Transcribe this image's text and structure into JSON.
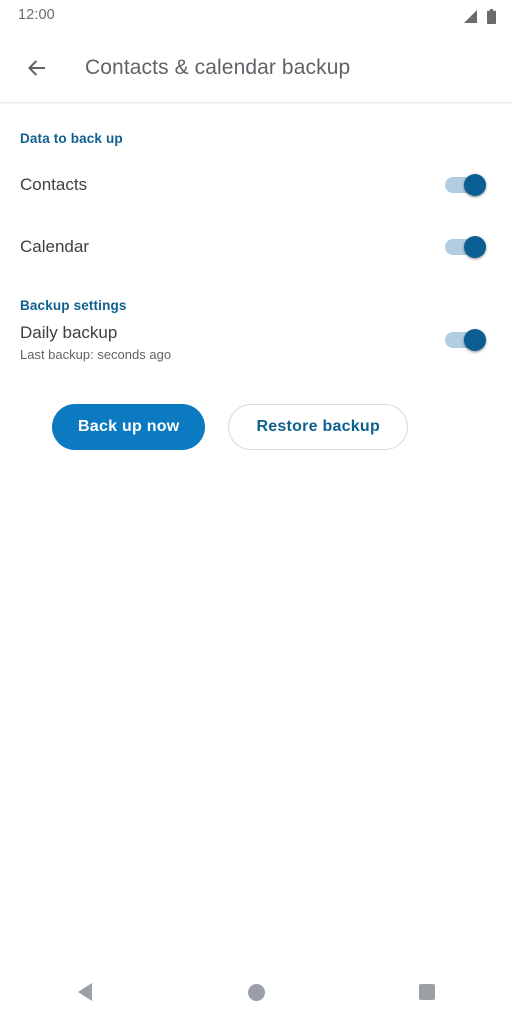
{
  "status_bar": {
    "time": "12:00",
    "signal_icon": "signal-bars-icon",
    "battery_icon": "battery-full-icon"
  },
  "app_bar": {
    "back_icon": "back-arrow-icon",
    "title": "Contacts & calendar backup"
  },
  "sections": {
    "data_to_back_up": {
      "header": "Data to back up",
      "rows": [
        {
          "title": "Contacts",
          "switch_state": "on"
        },
        {
          "title": "Calendar",
          "switch_state": "on"
        }
      ]
    },
    "backup_settings": {
      "header": "Backup settings",
      "rows": [
        {
          "title": "Daily backup",
          "subtitle": "Last backup: seconds ago",
          "switch_state": "on"
        }
      ]
    }
  },
  "actions": {
    "back_up_now_label": "Back up now",
    "restore_backup_label": "Restore backup"
  },
  "nav_bar": {
    "back_icon": "nav-back-triangle-icon",
    "home_icon": "nav-home-circle-icon",
    "recents_icon": "nav-recents-square-icon"
  },
  "colors": {
    "accent_blue": "#0b7ac0",
    "header_blue": "#10608f",
    "switch_track": "#b3cde0",
    "switch_thumb": "#0b5e94",
    "title_gray": "#5f6368",
    "nav_gray": "#9aa0a6"
  }
}
